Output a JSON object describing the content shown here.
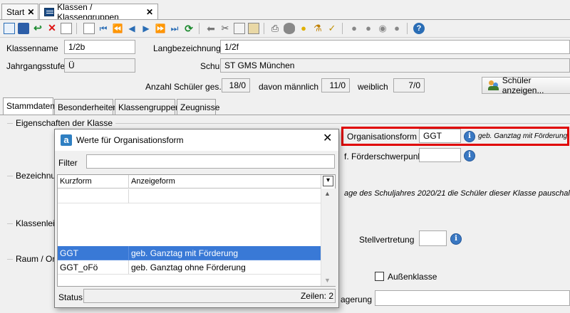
{
  "tabs": [
    {
      "label": "Start"
    },
    {
      "label": "Klassen / Klassengruppen"
    }
  ],
  "form": {
    "klassenname_label": "Klassenname",
    "klassenname_value": "1/2b",
    "langbezeichnung_label": "Langbezeichnung",
    "langbezeichnung_value": "1/2f",
    "jahrgangsstufe_label": "Jahrgangsstufe",
    "jahrgangsstufe_value": "Ü",
    "schule_label": "Schule",
    "schule_value": "ST GMS München",
    "anzahl_label": "Anzahl Schüler ges.",
    "anzahl_value": "18/0",
    "maennlich_label": "davon männlich",
    "maennlich_value": "11/0",
    "weiblich_label": "weiblich",
    "weiblich_value": "7/0",
    "schueler_button": "Schüler anzeigen..."
  },
  "subtabs": [
    {
      "label": "Stammdaten"
    },
    {
      "label": "Besonderheiten"
    },
    {
      "label": "Klassengruppen"
    },
    {
      "label": "Zeugnisse"
    }
  ],
  "stammdaten": {
    "group_eigenschaften": "Eigenschaften der Klasse",
    "group_bezeichnung": "Bezeichnu",
    "group_klassenleitung": "Klassenleit",
    "group_raum": "Raum / Ort",
    "organisationsform_label": "Organisationsform",
    "organisationsform_value": "GGT",
    "organisationsform_desc": "geb. Ganztag mit Förderung",
    "foerder_label": "f. Förderschwerpunkt",
    "foerder_value": "",
    "bemerkung_text": "age des Schuljahres 2020/21 die Schüler dieser Klasse pauschal",
    "stellvertretung_label": "Stellvertretung",
    "stellvertretung_value": "",
    "aussenklasse_label": "Außenklasse",
    "lagerung_label": "agerung",
    "lagerung_value": ""
  },
  "dialog": {
    "title": "Werte für Organisationsform",
    "filter_label": "Filter",
    "filter_value": "",
    "col_kurzform": "Kurzform",
    "col_anzeigeform": "Anzeigeform",
    "rows": [
      {
        "kurz": "",
        "anzeige": ""
      },
      {
        "kurz": "GGT",
        "anzeige": "geb. Ganztag mit Förderung"
      },
      {
        "kurz": "GGT_oFö",
        "anzeige": "geb. Ganztag ohne Förderung"
      }
    ],
    "status_label": "Status",
    "zeilen_text": "Zeilen: 2"
  },
  "colors": {
    "highlight_border": "#e00000",
    "selection": "#3979d6",
    "info_blue": "#3a78c2"
  }
}
